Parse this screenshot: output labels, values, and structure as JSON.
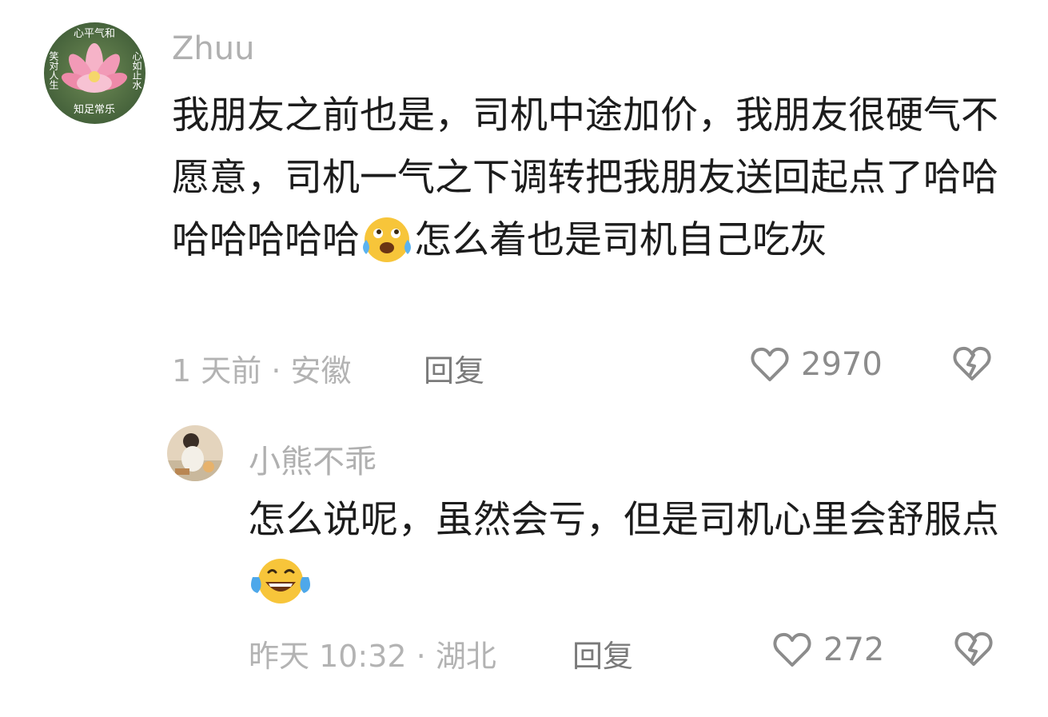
{
  "comments": [
    {
      "username": "Zhuu",
      "avatar_text": {
        "top": "心平气和",
        "left": "笑对人生",
        "right": "心如止水",
        "bottom": "知足常乐"
      },
      "text_before_emoji": "我朋友之前也是，司机中途加价，我朋友很硬气不愿意，司机一气之下调转把我朋友送回起点了哈哈哈哈哈哈哈",
      "emoji": "crying-laughing-face-icon",
      "text_after_emoji": "怎么着也是司机自己吃灰",
      "time_location": "1 天前 · 安徽",
      "reply_label": "回复",
      "like_count": "2970"
    },
    {
      "username": "小熊不乖",
      "text_before_emoji": "怎么说呢，虽然会亏，但是司机心里会舒服点",
      "emoji": "tears-of-joy-face-icon",
      "text_after_emoji": "",
      "time_location": "昨天 10:32 · 湖北",
      "reply_label": "回复",
      "like_count": "272"
    }
  ],
  "icons": {
    "like": "heart-outline-icon",
    "dislike": "broken-heart-icon"
  },
  "colors": {
    "text": "#1c1c1c",
    "muted": "#b3b3b3",
    "reply": "#7a7a7a",
    "icon": "#8c8c8c"
  }
}
